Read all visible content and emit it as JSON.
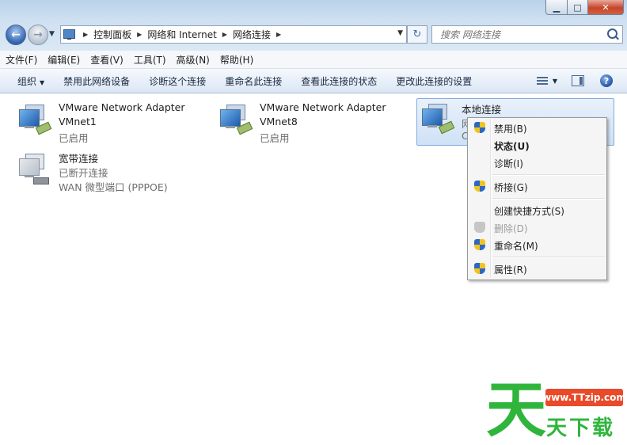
{
  "window": {
    "controls": {
      "minimize": "▁",
      "maximize": "□",
      "close": "✕"
    }
  },
  "nav": {
    "back_glyph": "←",
    "forward_glyph": "→",
    "dropdown_glyph": "▼"
  },
  "address": {
    "crumbs": [
      "控制面板",
      "网络和 Internet",
      "网络连接"
    ],
    "refresh_glyph": "↻"
  },
  "search": {
    "placeholder": "搜索 网络连接"
  },
  "menubar": [
    "文件(F)",
    "编辑(E)",
    "查看(V)",
    "工具(T)",
    "高级(N)",
    "帮助(H)"
  ],
  "commandbar": {
    "organize": "组织",
    "items": [
      "禁用此网络设备",
      "诊断这个连接",
      "重命名此连接",
      "查看此连接的状态",
      "更改此连接的设置"
    ],
    "help_glyph": "?"
  },
  "connections": [
    {
      "name": "VMware Network Adapter",
      "line2": "VMnet1",
      "status": "已启用",
      "icon": "network-adapter-icon"
    },
    {
      "name": "VMware Network Adapter",
      "line2": "VMnet8",
      "status": "已启用",
      "icon": "network-adapter-icon"
    },
    {
      "name": "本地连接",
      "line2": "网",
      "status": "C",
      "icon": "network-adapter-icon",
      "selected": true
    },
    {
      "name": "宽带连接",
      "line2": "已断开连接",
      "status": "WAN 微型端口 (PPPOE)",
      "icon": "broadband-disconnected-icon"
    }
  ],
  "context_menu": [
    {
      "label": "禁用(B)",
      "shield": true
    },
    {
      "label": "状态(U)",
      "bold": true
    },
    {
      "label": "诊断(I)"
    },
    {
      "label": "桥接(G)",
      "shield": true
    },
    {
      "label": "创建快捷方式(S)"
    },
    {
      "label": "删除(D)",
      "shield": true,
      "disabled": true
    },
    {
      "label": "重命名(M)",
      "shield": true
    },
    {
      "label": "属性(R)",
      "shield": true
    }
  ],
  "watermark": {
    "char": "天",
    "url": "www.TTzip.com",
    "text": "天下载"
  },
  "colors": {
    "accent": "#3399ff",
    "selection": "#cfe1f6",
    "watermark_green": "#2fb53c",
    "watermark_red": "#e94a2a"
  }
}
